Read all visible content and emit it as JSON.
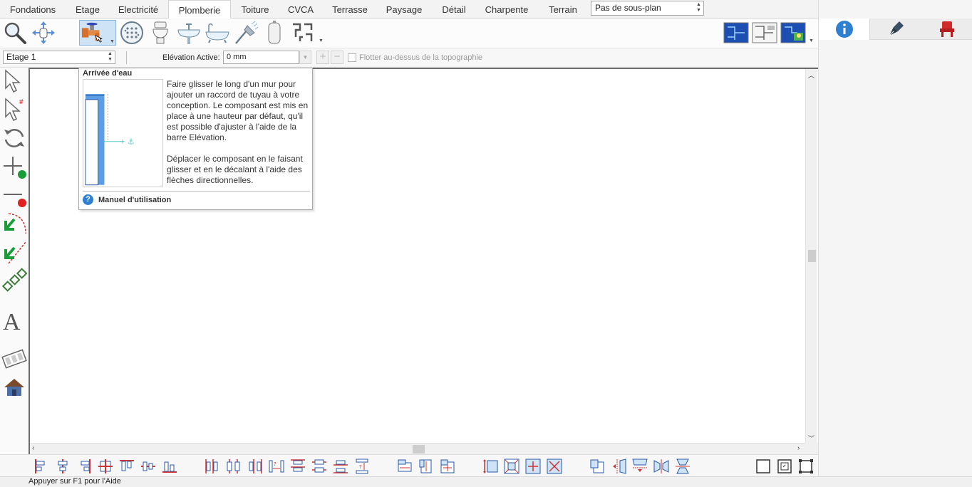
{
  "tabs": [
    {
      "label": "Fondations"
    },
    {
      "label": "Etage"
    },
    {
      "label": "Electricité"
    },
    {
      "label": "Plomberie"
    },
    {
      "label": "Toiture"
    },
    {
      "label": "CVCA"
    },
    {
      "label": "Terrasse"
    },
    {
      "label": "Paysage"
    },
    {
      "label": "Détail"
    },
    {
      "label": "Charpente"
    },
    {
      "label": "Terrain"
    }
  ],
  "active_tab": "Plomberie",
  "subplan_select": {
    "value": "Pas de sous-plan"
  },
  "ribbon_icons": [
    "magnifier-icon",
    "pan-hand-icon",
    "water-inlet-icon",
    "drain-grate-icon",
    "toilet-icon",
    "sink-icon",
    "bathtub-icon",
    "shower-icon",
    "water-heater-icon",
    "pipe-network-icon",
    "plan-view-icon",
    "plan-detail-icon",
    "plan-site-icon"
  ],
  "options_bar": {
    "floor_value": "Etage 1",
    "elevation_label": "Elévation Active:",
    "elevation_value": "0 mm",
    "float_label": "Flotter au-dessus de la topographie"
  },
  "tooltip": {
    "title": "Arrivée d'eau",
    "paragraph1": "Faire glisser le long d'un mur pour ajouter un raccord de tuyau à votre conception. Le composant est mis en place à une hauteur par défaut, qu'il est possible d'ajuster à l'aide de la barre Elévation.",
    "paragraph2": "Déplacer le composant en le faisant glisser et en le décalant à l'aide des flèches directionnelles.",
    "help_link": "Manuel d'utilisation"
  },
  "status_bar": {
    "text": "Appuyer sur F1 pour l'Aide"
  },
  "colors": {
    "accent_blue": "#2f80d1",
    "tool_green": "#1a9c3a",
    "tool_red": "#e02020",
    "pipe_orange": "#d9702a"
  }
}
